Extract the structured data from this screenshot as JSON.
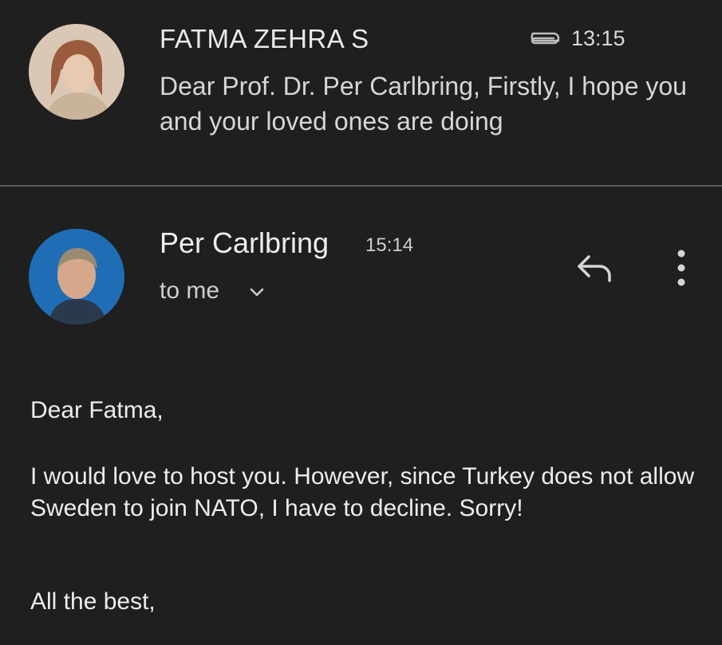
{
  "thread": {
    "first_message": {
      "sender": "FATMA ZEHRA S",
      "time": "13:15",
      "has_attachment_icon": "paperclip-icon",
      "snippet": "Dear Prof. Dr. Per Carlbring, Firstly, I hope you and your loved ones are doing"
    },
    "second_message": {
      "sender": "Per Carlbring",
      "time": "15:14",
      "recipient_label": "to me",
      "actions": {
        "reply_icon": "reply-icon",
        "more_icon": "more-vert-icon"
      },
      "body": {
        "greeting": "Dear Fatma,",
        "main": "I would love to host you. However, since Turkey does not allow Sweden to join NATO, I have to decline. Sorry!",
        "signoff": "All the best,"
      }
    }
  },
  "colors": {
    "background": "#1f1f1f",
    "text": "#e3e3e3",
    "divider": "#5a5a5a"
  }
}
